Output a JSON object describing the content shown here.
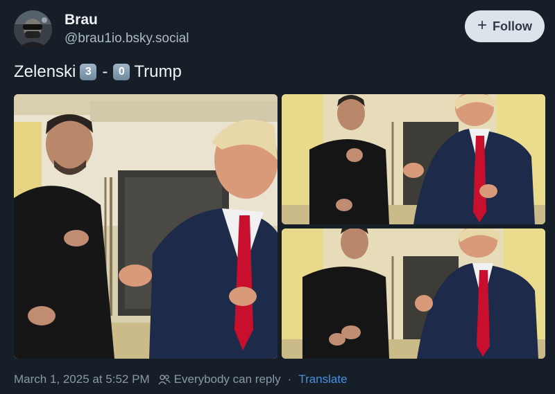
{
  "author": {
    "display_name": "Brau",
    "handle": "@brau1io.bsky.social",
    "avatar_icon": "masked-person-avatar"
  },
  "follow_button": {
    "label": "Follow",
    "icon": "plus-icon"
  },
  "post": {
    "text_left": "Zelenski",
    "score_left": "3",
    "separator": "-",
    "score_right": "0",
    "text_right": "Trump"
  },
  "images": [
    {
      "name": "photo-main",
      "icon": "photo"
    },
    {
      "name": "photo-top-right",
      "icon": "photo"
    },
    {
      "name": "photo-bottom-right",
      "icon": "photo"
    }
  ],
  "footer": {
    "timestamp": "March 1, 2025 at 5:52 PM",
    "reply_setting": "Everybody can reply",
    "dot": "·",
    "translate": "Translate"
  },
  "colors": {
    "background": "#161e27",
    "follow_button_bg": "#dde3ea",
    "link": "#4a8fe0",
    "muted_text": "#8a98a7",
    "tie_red": "#c8102e",
    "suit_navy": "#1e2a4a"
  }
}
